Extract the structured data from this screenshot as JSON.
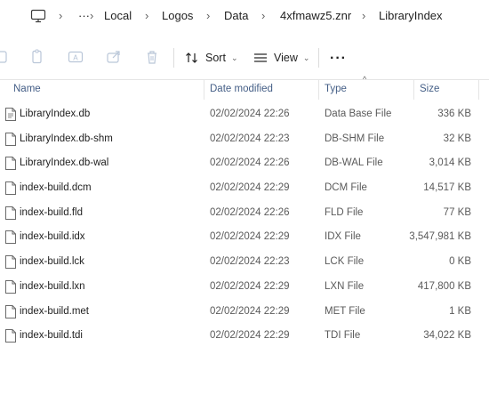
{
  "breadcrumb": {
    "overflow": "···",
    "items": [
      "Local",
      "Logos",
      "Data",
      "4xfmawz5.znr",
      "LibraryIndex"
    ]
  },
  "toolbar": {
    "sort_label": "Sort",
    "view_label": "View",
    "more_label": "···"
  },
  "columns": {
    "name": "Name",
    "date": "Date modified",
    "type": "Type",
    "size": "Size"
  },
  "files": [
    {
      "name": "LibraryIndex.db",
      "date": "02/02/2024 22:26",
      "type": "Data Base File",
      "size": "336 KB",
      "icon": "database-file-icon"
    },
    {
      "name": "LibraryIndex.db-shm",
      "date": "02/02/2024 22:23",
      "type": "DB-SHM File",
      "size": "32 KB",
      "icon": "file-icon"
    },
    {
      "name": "LibraryIndex.db-wal",
      "date": "02/02/2024 22:26",
      "type": "DB-WAL File",
      "size": "3,014 KB",
      "icon": "file-icon"
    },
    {
      "name": "index-build.dcm",
      "date": "02/02/2024 22:29",
      "type": "DCM File",
      "size": "14,517 KB",
      "icon": "file-icon"
    },
    {
      "name": "index-build.fld",
      "date": "02/02/2024 22:26",
      "type": "FLD File",
      "size": "77 KB",
      "icon": "file-icon"
    },
    {
      "name": "index-build.idx",
      "date": "02/02/2024 22:29",
      "type": "IDX File",
      "size": "3,547,981 KB",
      "icon": "file-icon"
    },
    {
      "name": "index-build.lck",
      "date": "02/02/2024 22:23",
      "type": "LCK File",
      "size": "0 KB",
      "icon": "file-icon"
    },
    {
      "name": "index-build.lxn",
      "date": "02/02/2024 22:29",
      "type": "LXN File",
      "size": "417,800 KB",
      "icon": "file-icon"
    },
    {
      "name": "index-build.met",
      "date": "02/02/2024 22:29",
      "type": "MET File",
      "size": "1 KB",
      "icon": "file-icon"
    },
    {
      "name": "index-build.tdi",
      "date": "02/02/2024 22:29",
      "type": "TDI File",
      "size": "34,022 KB",
      "icon": "file-icon"
    }
  ]
}
